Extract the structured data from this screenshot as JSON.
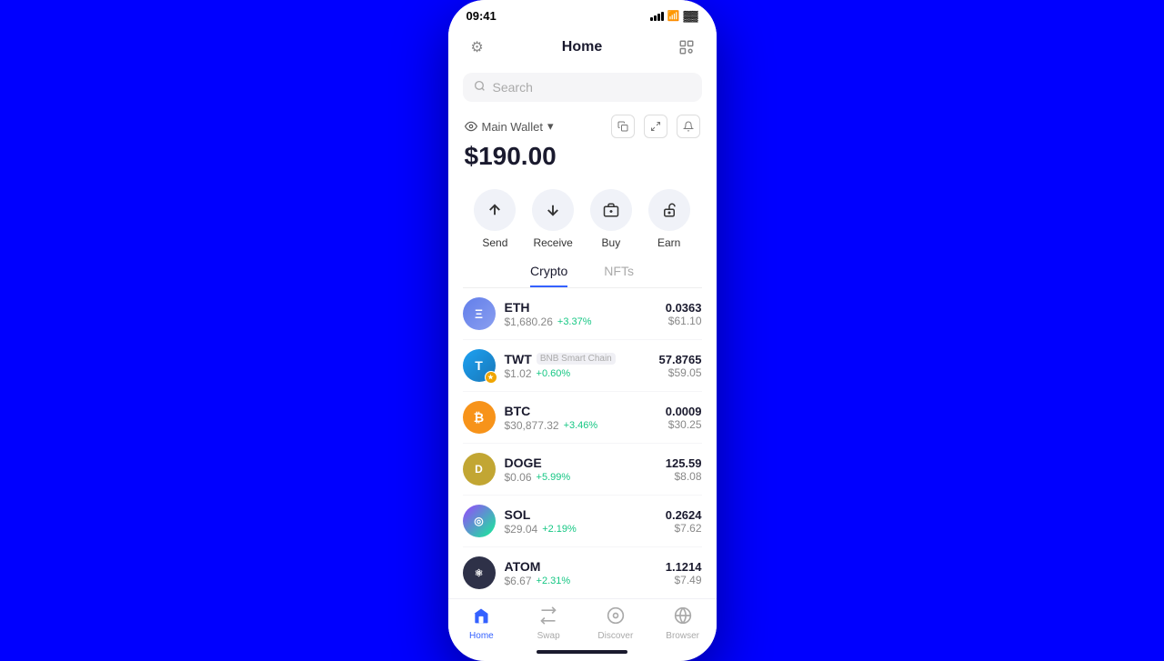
{
  "statusBar": {
    "time": "09:41"
  },
  "header": {
    "title": "Home",
    "settingsIcon": "⚙",
    "scanIcon": "🔗"
  },
  "search": {
    "placeholder": "Search"
  },
  "wallet": {
    "label": "Main Wallet",
    "balance": "$190.00"
  },
  "actions": [
    {
      "id": "send",
      "label": "Send",
      "icon": "↑"
    },
    {
      "id": "receive",
      "label": "Receive",
      "icon": "↓"
    },
    {
      "id": "buy",
      "label": "Buy",
      "icon": "≡"
    },
    {
      "id": "earn",
      "label": "Earn",
      "icon": "🔐"
    }
  ],
  "tabs": [
    {
      "id": "crypto",
      "label": "Crypto",
      "active": true
    },
    {
      "id": "nfts",
      "label": "NFTs",
      "active": false
    }
  ],
  "cryptoList": [
    {
      "ticker": "ETH",
      "network": null,
      "price": "$1,680.26",
      "change": "+3.37%",
      "amount": "0.0363",
      "usd": "$61.10",
      "iconClass": "eth-icon",
      "initials": "Ξ"
    },
    {
      "ticker": "TWT",
      "network": "BNB Smart Chain",
      "price": "$1.02",
      "change": "+0.60%",
      "amount": "57.8765",
      "usd": "$59.05",
      "iconClass": "twt-icon",
      "initials": "T"
    },
    {
      "ticker": "BTC",
      "network": null,
      "price": "$30,877.32",
      "change": "+3.46%",
      "amount": "0.0009",
      "usd": "$30.25",
      "iconClass": "btc-icon",
      "initials": "₿"
    },
    {
      "ticker": "DOGE",
      "network": null,
      "price": "$0.06",
      "change": "+5.99%",
      "amount": "125.59",
      "usd": "$8.08",
      "iconClass": "doge-icon",
      "initials": "D"
    },
    {
      "ticker": "SOL",
      "network": null,
      "price": "$29.04",
      "change": "+2.19%",
      "amount": "0.2624",
      "usd": "$7.62",
      "iconClass": "sol-icon",
      "initials": "◎"
    },
    {
      "ticker": "ATOM",
      "network": null,
      "price": "$6.67",
      "change": "+2.31%",
      "amount": "1.1214",
      "usd": "$7.49",
      "iconClass": "atom-icon",
      "initials": "⚛"
    }
  ],
  "bottomNav": [
    {
      "id": "home",
      "label": "Home",
      "icon": "⌂",
      "active": true
    },
    {
      "id": "swap",
      "label": "Swap",
      "icon": "⇄",
      "active": false
    },
    {
      "id": "discover",
      "label": "Discover",
      "icon": "◉",
      "active": false
    },
    {
      "id": "browser",
      "label": "Browser",
      "icon": "⊙",
      "active": false
    }
  ]
}
